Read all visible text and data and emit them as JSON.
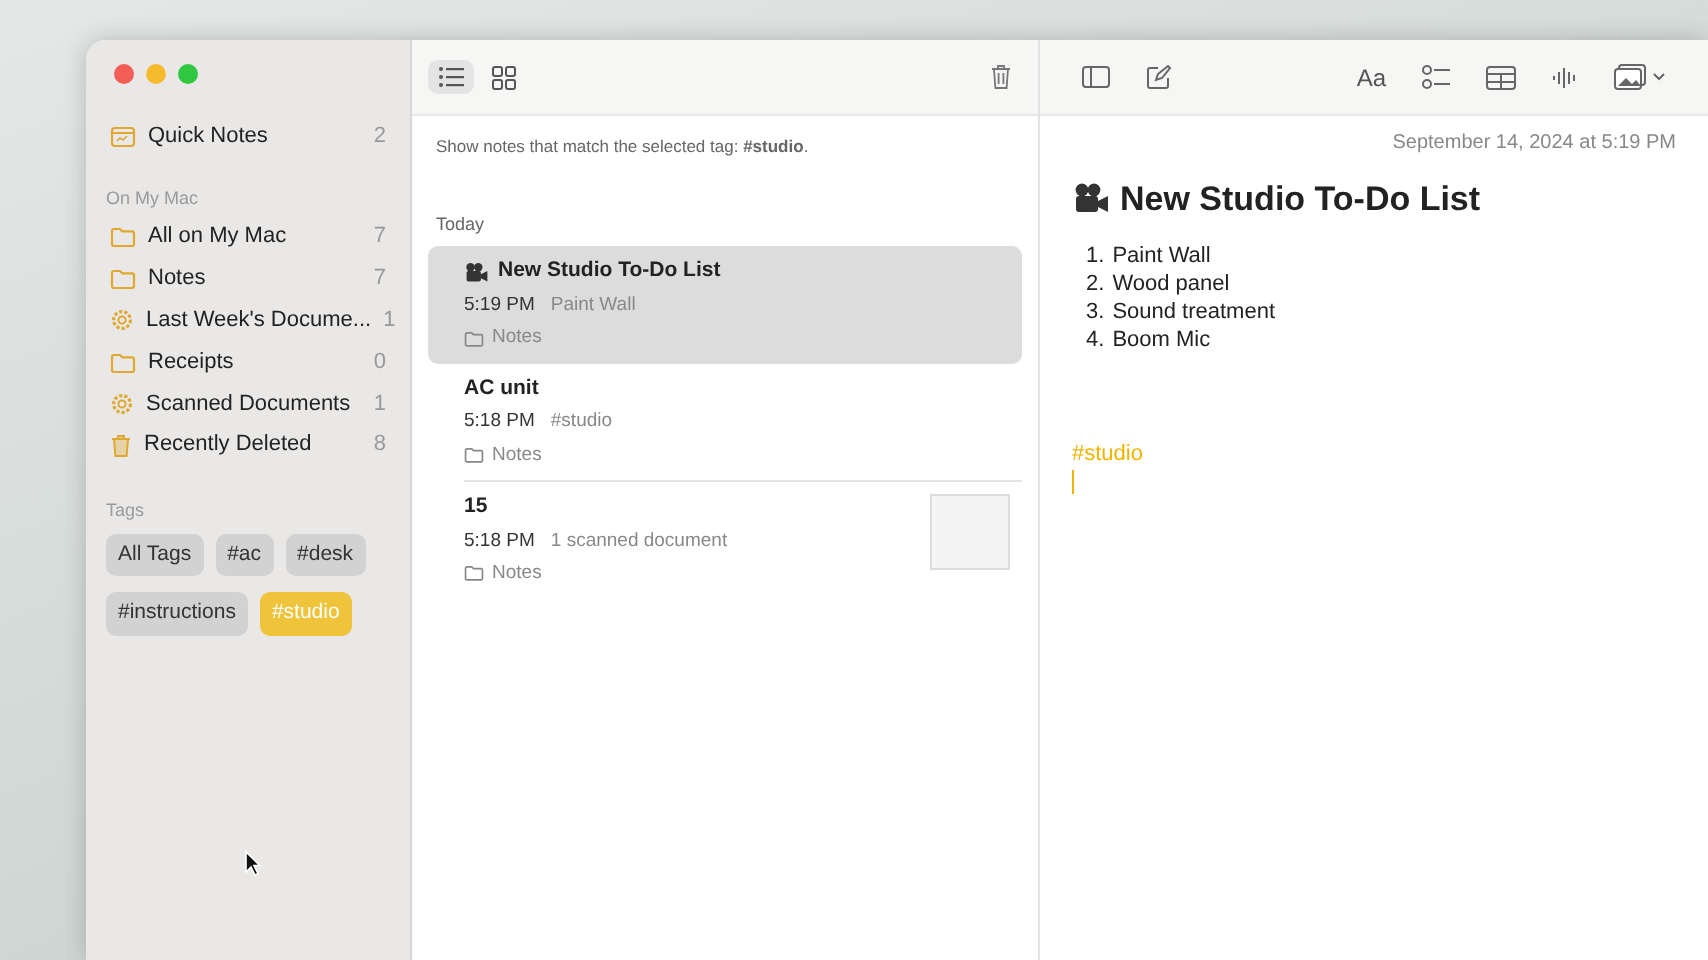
{
  "sidebar": {
    "quick_notes": {
      "label": "Quick Notes",
      "count": "2"
    },
    "section": "On My Mac",
    "items": [
      {
        "kind": "folder",
        "label": "All on My Mac",
        "count": "7"
      },
      {
        "kind": "folder",
        "label": "Notes",
        "count": "7"
      },
      {
        "kind": "smart",
        "label": "Last Week's Docume...",
        "count": "1"
      },
      {
        "kind": "folder",
        "label": "Receipts",
        "count": "0"
      },
      {
        "kind": "smart",
        "label": "Scanned Documents",
        "count": "1"
      },
      {
        "kind": "trash",
        "label": "Recently Deleted",
        "count": "8"
      }
    ],
    "tags_heading": "Tags",
    "tags": [
      {
        "label": "All Tags",
        "selected": false
      },
      {
        "label": "#ac",
        "selected": false
      },
      {
        "label": "#desk",
        "selected": false
      },
      {
        "label": "#instructions",
        "selected": false
      },
      {
        "label": "#studio",
        "selected": true
      }
    ]
  },
  "note_list": {
    "view_buttons": [
      {
        "selected": true
      },
      {
        "selected": false
      }
    ],
    "filter_message": "Show notes that match the selected tag: **#studio**.",
    "group": "Today",
    "notes": [
      {
        "title": "New Studio To-Do List",
        "has_icon": true,
        "time": "5:19 PM",
        "preview": "Paint Wall",
        "folder": "Notes",
        "thumbnail": false,
        "selected": true
      },
      {
        "title": "AC unit",
        "has_icon": false,
        "time": "5:18 PM",
        "preview": "#studio",
        "folder": "Notes",
        "thumbnail": false,
        "selected": false
      },
      {
        "title": "15",
        "has_icon": false,
        "time": "5:18 PM",
        "preview": "1 scanned document",
        "folder": "Notes",
        "thumbnail": true,
        "selected": false
      }
    ]
  },
  "editor": {
    "format_label": "Aa",
    "date": "September 14, 2024 at 5:19 PM",
    "title": "New Studio To-Do List",
    "items": [
      {
        "number": "1.",
        "text": "Paint Wall"
      },
      {
        "number": "2.",
        "text": "Wood panel"
      },
      {
        "number": "3.",
        "text": "Sound treatment"
      },
      {
        "number": "4.",
        "text": "Boom Mic"
      }
    ],
    "tag": "#studio"
  }
}
